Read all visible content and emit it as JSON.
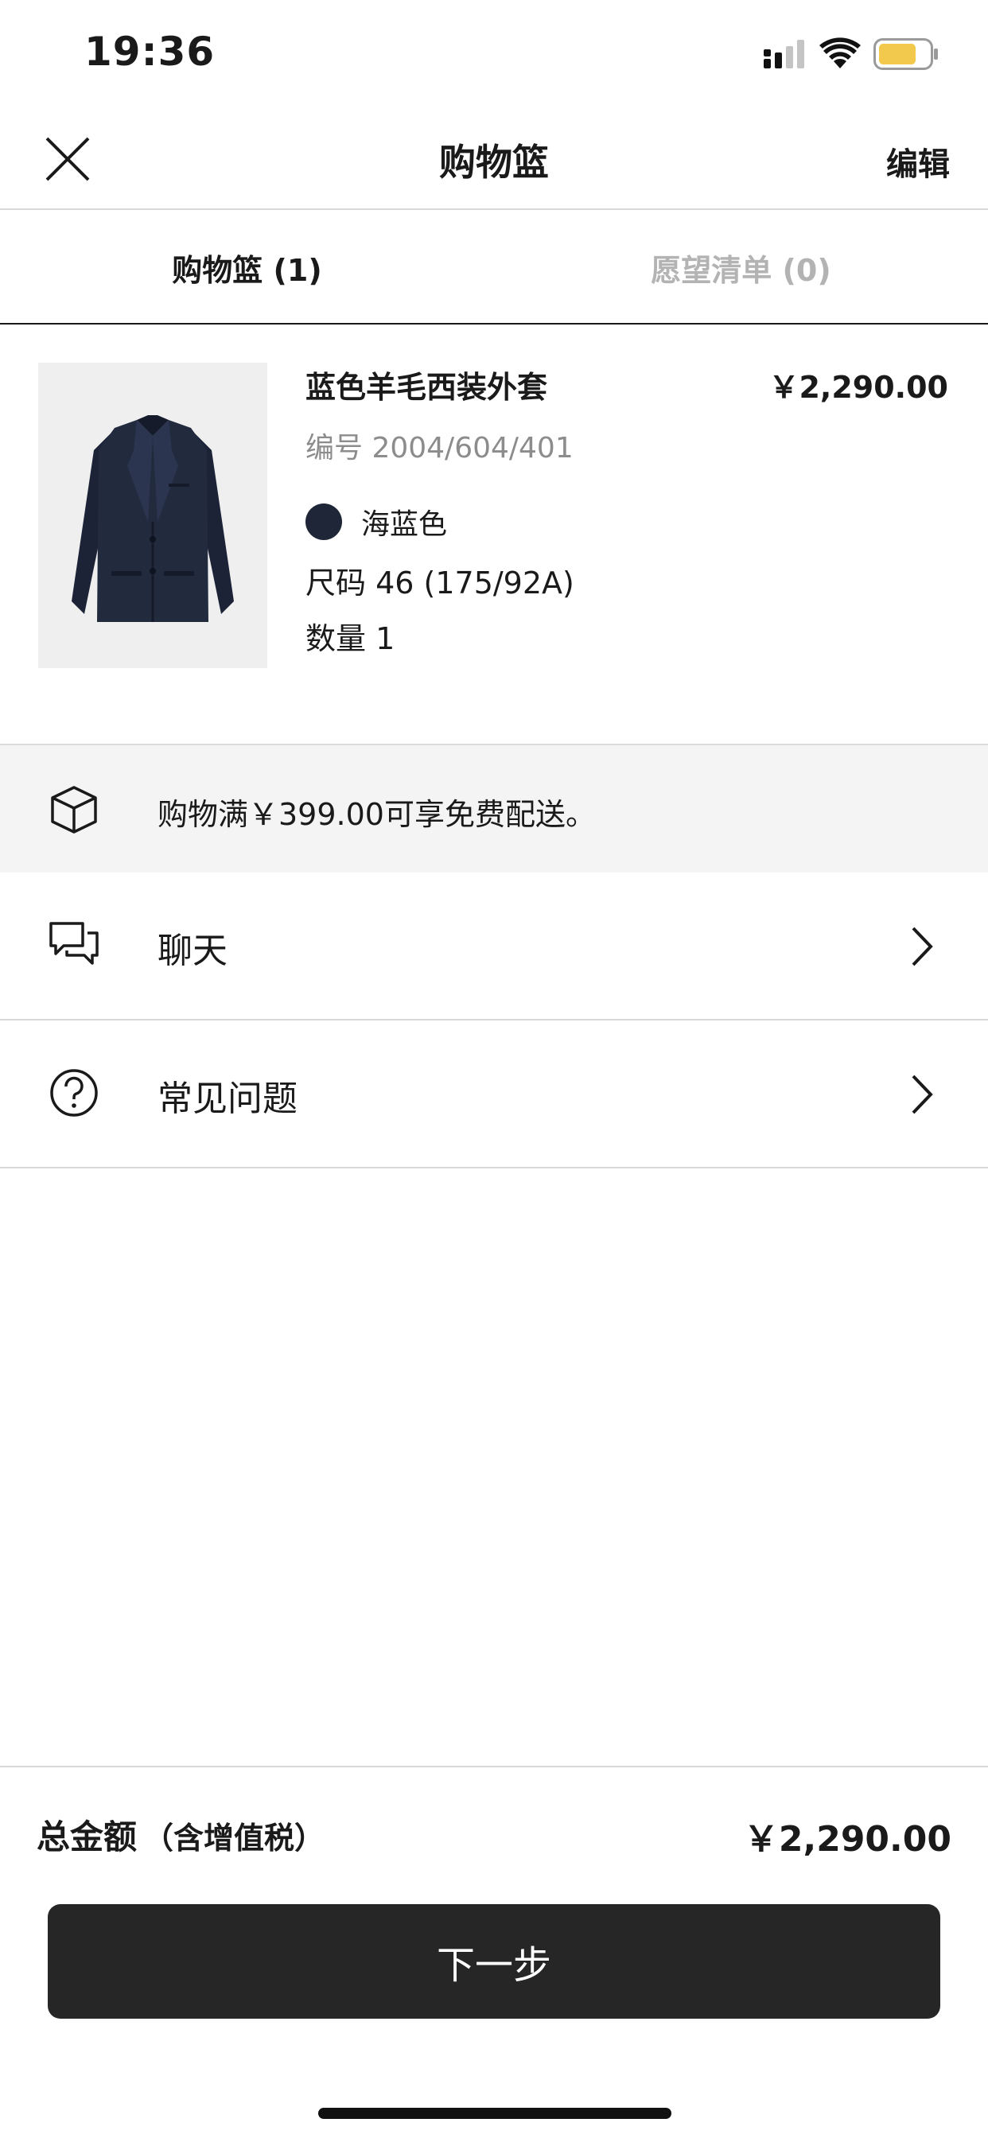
{
  "status_bar": {
    "time": "19:36",
    "battery_color": "#f2c94c"
  },
  "header": {
    "title": "购物篮",
    "edit_label": "编辑",
    "close_icon": "close-icon"
  },
  "tabs": [
    {
      "label": "购物篮 (1)",
      "active": true
    },
    {
      "label": "愿望清单 (0)",
      "active": false
    }
  ],
  "cart_item": {
    "name": "蓝色羊毛西装外套",
    "price": "￥2,290.00",
    "reference": "编号 2004/604/401",
    "color_name": "海蓝色",
    "color_hex": "#1e2638",
    "size": "尺码 46 (175/92A)",
    "quantity": "数量 1"
  },
  "shipping": {
    "text": "购物满￥399.00可享免费配送。",
    "icon": "box-icon"
  },
  "menu": [
    {
      "label": "聊天",
      "icon": "chat-icon"
    },
    {
      "label": "常见问题",
      "icon": "help-icon"
    }
  ],
  "footer": {
    "total_label": "总金额",
    "total_note": "（含增值税）",
    "total_price": "￥2,290.00",
    "next_label": "下一步"
  }
}
